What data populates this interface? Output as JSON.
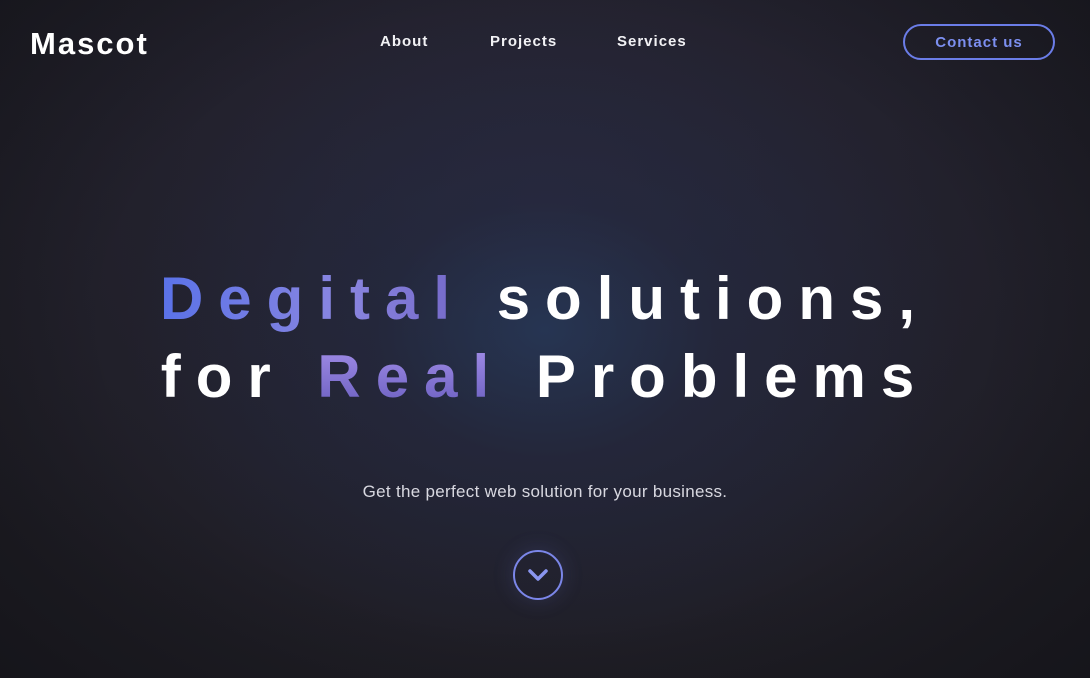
{
  "brand": {
    "name": "Mascot"
  },
  "nav": {
    "items": [
      {
        "label": "About"
      },
      {
        "label": "Projects"
      },
      {
        "label": "Services"
      }
    ],
    "contact_label": "Contact us"
  },
  "hero": {
    "line1_highlight": "Degital",
    "line1_rest": "solutions,",
    "line2_pre": "for",
    "line2_highlight": "Real",
    "line2_rest": "Problems",
    "subtitle": "Get the perfect web solution for your business."
  },
  "icons": {
    "scroll_down": "chevron-down-icon"
  },
  "colors": {
    "background": "#1e1d24",
    "accent": "#6b7de8",
    "highlight_blue": "#5a72e8",
    "highlight_purple": "#a38ee8",
    "text": "#ffffff"
  }
}
